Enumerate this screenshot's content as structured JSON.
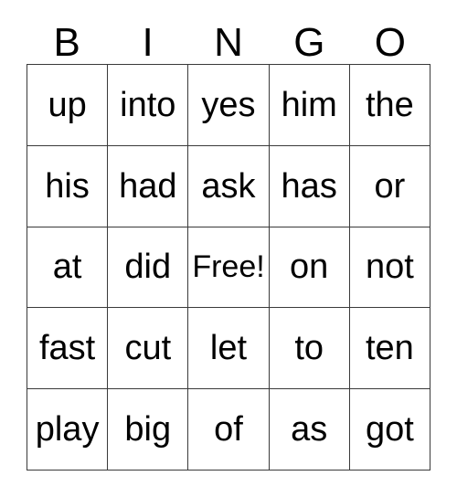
{
  "card": {
    "title_letters": [
      "B",
      "I",
      "N",
      "G",
      "O"
    ],
    "free_space_label": "Free!",
    "border_color": "#3a3a3a",
    "text_color": "#000000",
    "background_color": "#ffffff",
    "rows": [
      [
        "up",
        "into",
        "yes",
        "him",
        "the"
      ],
      [
        "his",
        "had",
        "ask",
        "has",
        "or"
      ],
      [
        "at",
        "did",
        "Free!",
        "on",
        "not"
      ],
      [
        "fast",
        "cut",
        "let",
        "to",
        "ten"
      ],
      [
        "play",
        "big",
        "of",
        "as",
        "got"
      ]
    ]
  }
}
